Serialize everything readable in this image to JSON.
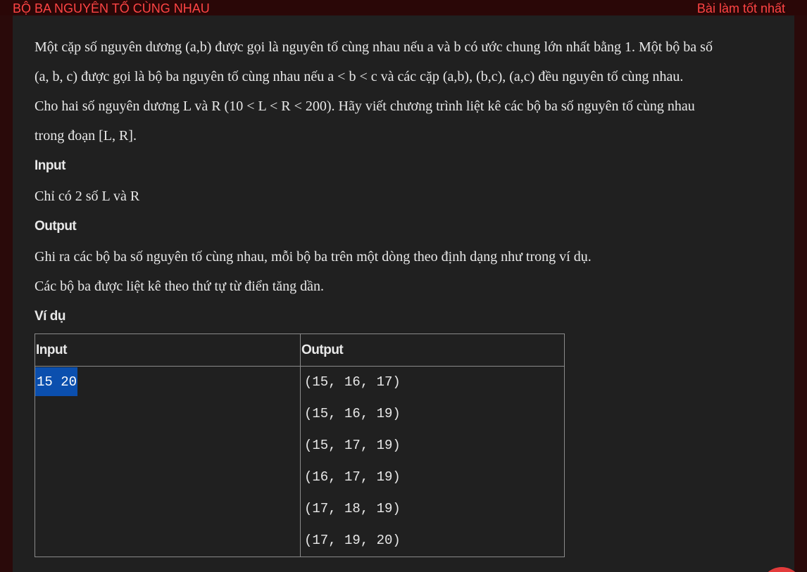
{
  "header": {
    "title": "BỘ BA NGUYÊN TỐ CÙNG NHAU",
    "best_link": "Bài làm tốt nhất"
  },
  "problem": {
    "description": [
      "Một cặp số nguyên dương (a,b) được gọi là nguyên tố cùng nhau nếu a và b có ước chung lớn nhất bằng 1. Một bộ ba số",
      "(a, b, c) được gọi là bộ ba nguyên tố cùng nhau nếu a < b < c và các cặp (a,b), (b,c), (a,c) đều nguyên tố cùng nhau.",
      "Cho hai số nguyên dương L và R (10 < L < R < 200). Hãy viết chương trình liệt kê các bộ ba số nguyên tố cùng nhau",
      "trong đoạn [L, R]."
    ],
    "input_heading": "Input",
    "input_text": "Chỉ có 2 số L và R",
    "output_heading": "Output",
    "output_text": [
      "Ghi ra các bộ ba số nguyên tố cùng nhau, mỗi bộ ba trên một dòng theo định dạng như trong ví dụ.",
      "Các bộ ba được liệt kê theo thứ tự từ điển tăng dần."
    ],
    "example_heading": "Ví dụ"
  },
  "example_table": {
    "headers": [
      "Input",
      "Output"
    ],
    "input_value": "15 20",
    "output_lines": [
      "(15, 16, 17)",
      "(15, 16, 19)",
      "(15, 17, 19)",
      "(16, 17, 19)",
      "(17, 18, 19)",
      "(17, 19, 20)"
    ]
  },
  "colors": {
    "accent": "#ff4444",
    "selection": "#0b4fae",
    "background": "#202020"
  }
}
